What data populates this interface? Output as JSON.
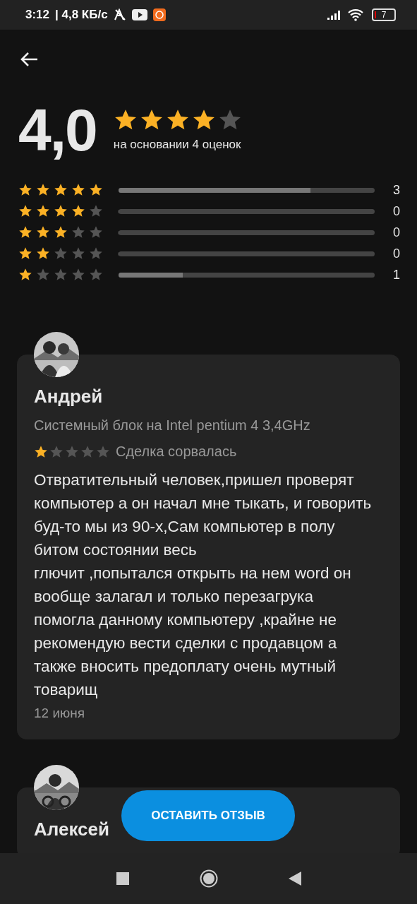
{
  "status_bar": {
    "time": "3:12",
    "speed": "| 4,8 КБ/с",
    "battery": "7"
  },
  "summary": {
    "score": "4,0",
    "stars": 4,
    "caption": "на основании 4 оценок"
  },
  "distribution": [
    {
      "stars": 5,
      "level": 0.75,
      "count": "3"
    },
    {
      "stars": 4,
      "level": 0,
      "count": "0"
    },
    {
      "stars": 3,
      "level": 0,
      "count": "0"
    },
    {
      "stars": 2,
      "level": 0,
      "count": "0"
    },
    {
      "stars": 1,
      "level": 0.25,
      "count": "1"
    }
  ],
  "reviews": [
    {
      "author": "Андрей",
      "item": "Системный блок на Intel pentium 4 3,4GHz",
      "stars": 1,
      "status": "Сделка сорвалась",
      "text": "Отвратительный человек,пришел проверят компьютер а он начал мне тыкать, и говорить буд-то мы из 90-х,Сам компьютер в полу битом состоянии весь\nглючит ,попытался открыть на нем word он вообще залагал и только перезагрука помогла данному компьютеру ,крайне не рекомендую вести сделки с продавцом а также вносить предоплату очень мутный товарищ",
      "date": "12 июня"
    },
    {
      "author": "Алексей"
    }
  ],
  "action_button": "ОСТАВИТЬ ОТЗЫВ"
}
